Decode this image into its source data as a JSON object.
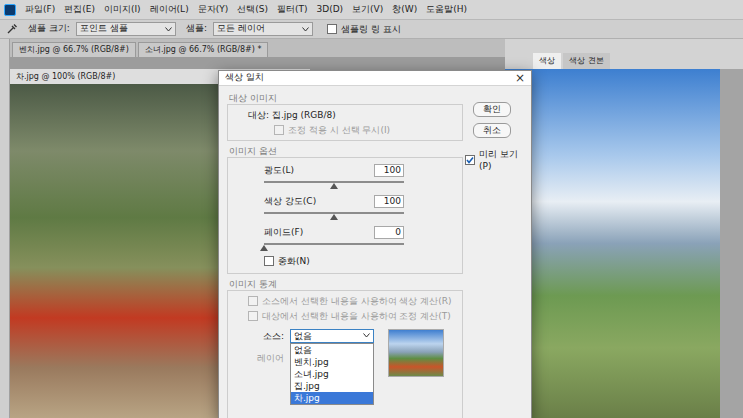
{
  "menu": [
    "파일(F)",
    "편집(E)",
    "이미지(I)",
    "레이어(L)",
    "문자(Y)",
    "선택(S)",
    "필터(T)",
    "3D(D)",
    "보기(V)",
    "창(W)",
    "도움말(H)"
  ],
  "options_bar": {
    "sample_size_label": "샘플 크기:",
    "sample_size": "포인트 샘플",
    "sample_label": "샘플:",
    "sample": "모든 레이어",
    "show_ring": {
      "label": "샘플링 링 표시",
      "checked": false
    }
  },
  "document_tabs": [
    {
      "label": "벤치.jpg @ 66.7% (RGB/8#)",
      "selected": false
    },
    {
      "label": "소녀.jpg @ 66.7% (RGB/8#) *",
      "selected": false
    },
    {
      "label": "차.jpg @ 100% (RGB/8#)",
      "selected": true
    }
  ],
  "panel_tabs": [
    {
      "label": "색상",
      "selected": true
    },
    {
      "label": "색상 견본",
      "selected": false
    }
  ],
  "dialog": {
    "title": "색상 일치",
    "close": "×",
    "target_group": {
      "title": "대상 이미지",
      "target": "대상: 집.jpg (RGB/8)",
      "ignore_selection": {
        "label": "조정 적용 시 선택 무시(I)",
        "checked": false,
        "disabled": true
      }
    },
    "options_group": {
      "title": "이미지 옵션",
      "sliders": [
        {
          "label": "광도(L)",
          "value": "100",
          "level": 0.5
        },
        {
          "label": "색상 강도(C)",
          "value": "100",
          "level": 0.5
        },
        {
          "label": "페이드(F)",
          "value": "0",
          "level": 0
        }
      ],
      "neutralize": {
        "label": "중화(N)",
        "checked": false
      }
    },
    "stats_group": {
      "title": "이미지 통계",
      "checks": [
        {
          "label": "소스에서 선택한 내용을 사용하여 색상 계산(R)",
          "checked": false,
          "disabled": true
        },
        {
          "label": "대상에서 선택한 내용을 사용하여 조정 계산(T)",
          "checked": false,
          "disabled": true
        }
      ],
      "source": {
        "label": "소스:",
        "value": "없음",
        "open": true,
        "options": [
          {
            "label": "없음",
            "selected": false
          },
          {
            "label": "벤치.jpg",
            "selected": false
          },
          {
            "label": "소녀.jpg",
            "selected": false
          },
          {
            "label": "집.jpg",
            "selected": false
          },
          {
            "label": "차.jpg",
            "selected": true
          }
        ]
      },
      "layer_label": "레이어"
    },
    "buttons": [
      "확인",
      "취소"
    ],
    "preview": {
      "label": "미리 보기(P)",
      "checked": true
    }
  }
}
